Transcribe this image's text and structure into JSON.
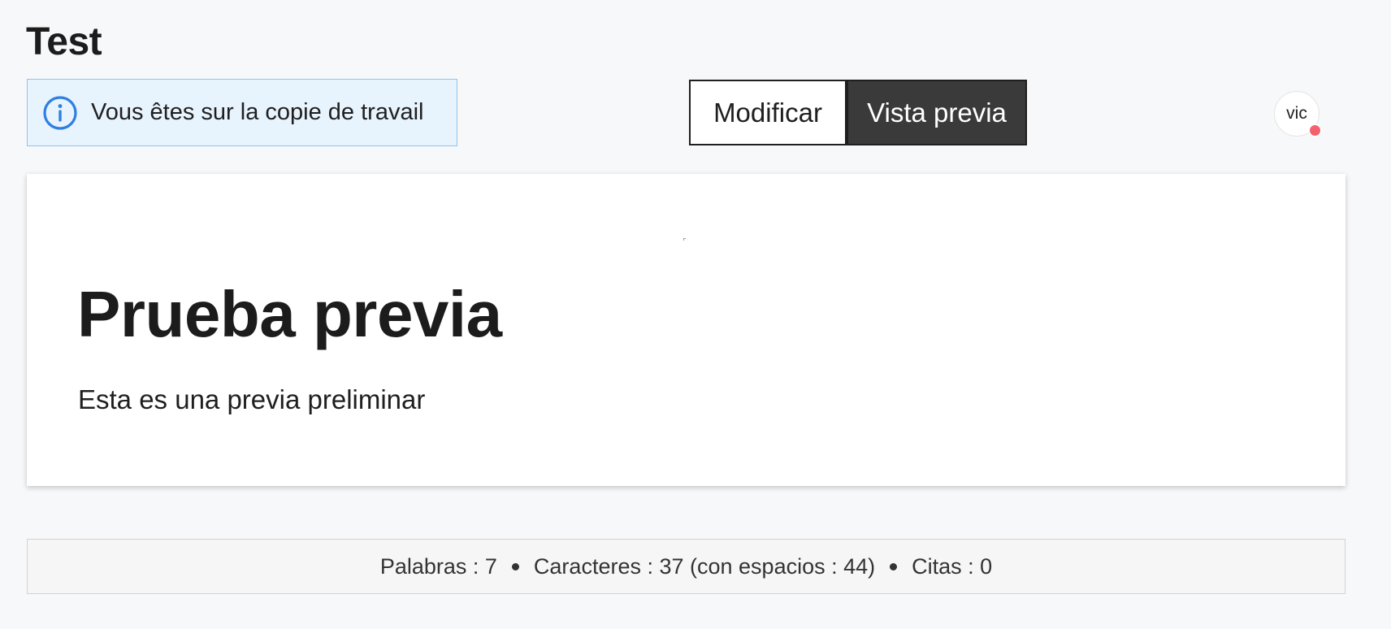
{
  "header": {
    "title": "Test"
  },
  "banner": {
    "icon": "info-icon",
    "text": "Vous êtes sur la copie de travail",
    "accent_color": "#2f7fe0"
  },
  "mode_switch": {
    "edit_label": "Modificar",
    "preview_label": "Vista previa",
    "active": "preview"
  },
  "user": {
    "avatar_label": "vic",
    "presence_color": "#f3626d"
  },
  "preview": {
    "heading": "Prueba previa",
    "paragraph": "Esta es una previa preliminar"
  },
  "stats": {
    "words": "Palabras : 7",
    "characters": "Caracteres : 37 (con espacios : 44)",
    "citations": "Citas : 0"
  }
}
